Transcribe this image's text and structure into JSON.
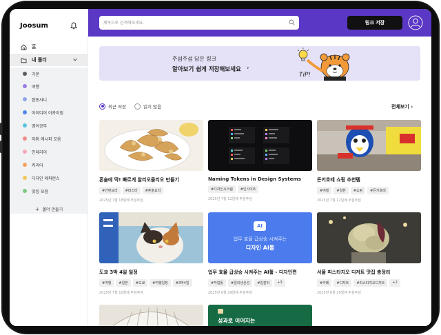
{
  "app": {
    "name": "Joosum"
  },
  "sidebar": {
    "home_label": "홈",
    "my_folders_label": "내 폴더",
    "folders": [
      {
        "label": "기본",
        "color": "#5c5c5c"
      },
      {
        "label": "여행",
        "color": "#9b7be6"
      },
      {
        "label": "잡동사니",
        "color": "#8ea4e8"
      },
      {
        "label": "아이디어 아카이빙",
        "color": "#4f86e8"
      },
      {
        "label": "영어공부",
        "color": "#55c5d9"
      },
      {
        "label": "자취 레시피 모음",
        "color": "#f08a8a"
      },
      {
        "label": "인테리어",
        "color": "#f4a8b8"
      },
      {
        "label": "커리어",
        "color": "#f6a25c"
      },
      {
        "label": "디자인 레퍼런스",
        "color": "#f3c85a"
      },
      {
        "label": "맛집 모음",
        "color": "#7cc97a"
      }
    ],
    "make_folder_label": "폴더 만들기"
  },
  "topbar": {
    "search_placeholder": "제목으로 검색해보세요.",
    "save_link_label": "링크 저장"
  },
  "banner": {
    "line1": "주섬주섬 담은 링크",
    "line2": "알아보기 쉽게 저장해보세요",
    "arrow": "›",
    "tip_text": "TiP!"
  },
  "sort": {
    "options": [
      "최근 저장",
      "읽지 않음"
    ],
    "selected": "최근 저장",
    "see_all_label": "전체보기"
  },
  "cards": [
    {
      "title": "혼술에 딱! 빠르게 알리오올리오 만들기",
      "tags": [
        "#간편요리",
        "#파스타",
        "#혼술요리"
      ],
      "date": "2025년 7월 18일에 주섬주섬"
    },
    {
      "title": "Naming Tokens in Design Systems",
      "tags": [
        "#디자인시스템",
        "#인사이트"
      ],
      "date": "2025년 7월 12일에 주섬주섬"
    },
    {
      "title": "돈키호테 쇼핑 추천템",
      "tags": [
        "#여행",
        "#일본",
        "#쇼핑",
        "#돈키호테"
      ],
      "date": "2025년 7월 12일에 주섬주섬"
    },
    {
      "title": "도쿄 3박 4일 일정",
      "tags": [
        "#여행",
        "#일본",
        "#도쿄",
        "#여행일정",
        "#3박4일"
      ],
      "date": "2025년 7월 10일에 주섬주섬"
    },
    {
      "title": "업무 효율 급상승 시켜주는 AI툴 - 디자인편",
      "tags": [
        "#작업툴",
        "#일의생산성",
        "#일잘러",
        "+3"
      ],
      "date": "2025년 6월 29일에 주섬주섬",
      "thumb_line1": "업무 효율 급상승 시켜주는",
      "thumb_line2": "디자인 AI툴",
      "thumb_badge": "AI"
    },
    {
      "title": "서울 피스타치오 디저트 맛집 총정리",
      "tags": [
        "#카페",
        "#디저트",
        "#피스타치오디저트",
        "+2"
      ],
      "date": "2025년 6월 29일에 주섬주섬"
    },
    {
      "title": "",
      "tags": [],
      "date": ""
    },
    {
      "title": "",
      "tags": [],
      "date": "",
      "thumb_line1": "성과로 이어지는"
    }
  ],
  "colors": {
    "brand": "#5a37c4",
    "banner_bg": "#e5e1f7",
    "button_dark": "#111111"
  }
}
